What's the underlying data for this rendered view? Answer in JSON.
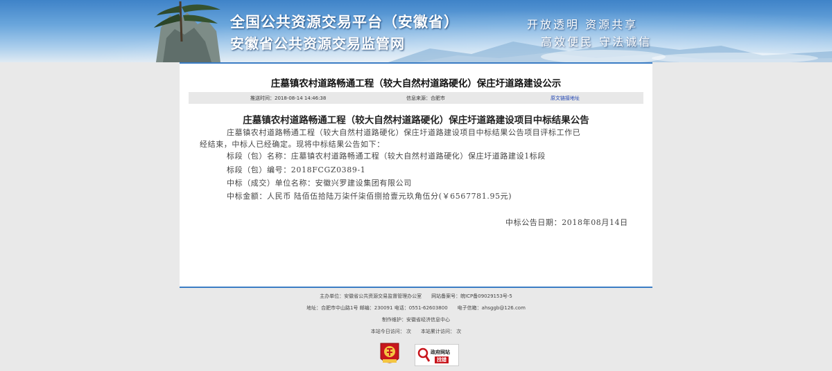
{
  "header": {
    "title_line1": "全国公共资源交易平台（安徽省）",
    "title_line2": "安徽省公共资源交易监管网",
    "slogan_line1": "开放透明 资源共享",
    "slogan_line2": "高效便民 守法诚信"
  },
  "article": {
    "title": "庄墓镇农村道路畅通工程（较大自然村道路硬化）保庄圩道路建设公示",
    "publish_time": "推送时间：2018-08-14 14:46:38",
    "source": "信息来源：合肥市",
    "original_link": "原文链接地址",
    "notice_title": "庄墓镇农村道路畅通工程（较大自然村道路硬化）保庄圩道路建设项目中标结果公告",
    "para1_line1": "庄墓镇农村道路畅通工程（较大自然村道路硬化）保庄圩道路建设项目中标结果公告项目评标工作已",
    "para1_line2": "经结束，中标人已经确定。现将中标结果公告如下：",
    "section_name": "标段（包）名称：庄墓镇农村道路畅通工程（较大自然村道路硬化）保庄圩道路建设1标段",
    "section_no": "标段（包）编号：2018FCGZ0389-1",
    "winner": "中标（成交）单位名称：安徽兴罗建设集团有限公司",
    "amount": "中标金额：人民币 陆佰伍拾陆万柒仟柒佰捌拾壹元玖角伍分(￥6567781.95元)",
    "date": "中标公告日期：2018年08月14日"
  },
  "footer": {
    "sponsor": "主办单位：安徽省公共资源交易监督管理办公室",
    "icp": "网站备案号：皖ICP备09029153号-5",
    "address": "地址：合肥市中山路1号 邮编：230091 电话：0551-62603800",
    "email": "电子信箱：ahsggb@126.com",
    "maintainer": "制作维护：安徽省经济信息中心",
    "today_visits": "本站今日访问：  次",
    "total_visits": "本站累计访问：  次",
    "gov_badge_line1": "政府网站",
    "gov_badge_line2": "找错"
  },
  "colors": {
    "accent": "#3a7cc4",
    "link": "#1a3fb0",
    "badge_red": "#c8161d"
  }
}
